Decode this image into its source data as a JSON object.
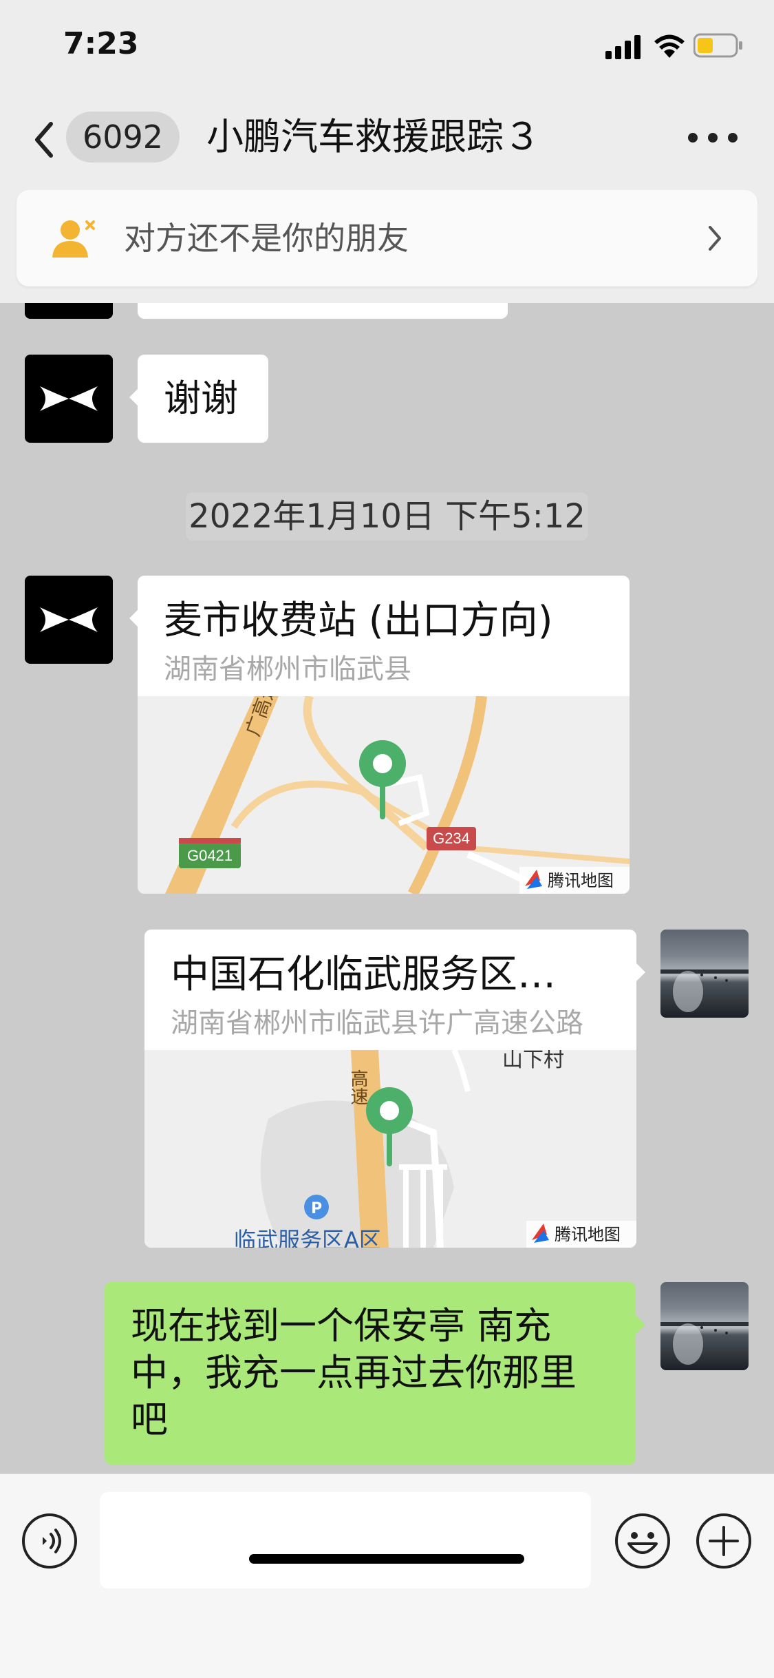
{
  "status": {
    "time": "7:23"
  },
  "nav": {
    "unread_count": "6092",
    "title": "小鹏汽车救援跟踪３"
  },
  "banner": {
    "text": "对方还不是你的朋友"
  },
  "messages": {
    "thanks": "谢谢",
    "timestamp": "2022年1月10日 下午5:12",
    "location1": {
      "name": "麦市收费站 (出口方向)",
      "address": "湖南省郴州市临武县",
      "map_labels": [
        "广高速",
        "G0421",
        "G234"
      ],
      "provider": "腾讯地图"
    },
    "location2": {
      "name": "中国石化临武服务区…",
      "address": "湖南省郴州市临武县许广高速公路",
      "map_labels": [
        "山下村",
        "高速",
        "临武服务区A区"
      ],
      "provider": "腾讯地图"
    },
    "reply": "现在找到一个保安亭 南充中，我充一点再过去你那里吧"
  },
  "colors": {
    "accent_green": "#a9e879",
    "pin_green": "#4caf6a",
    "highway": "#f0c27a"
  }
}
